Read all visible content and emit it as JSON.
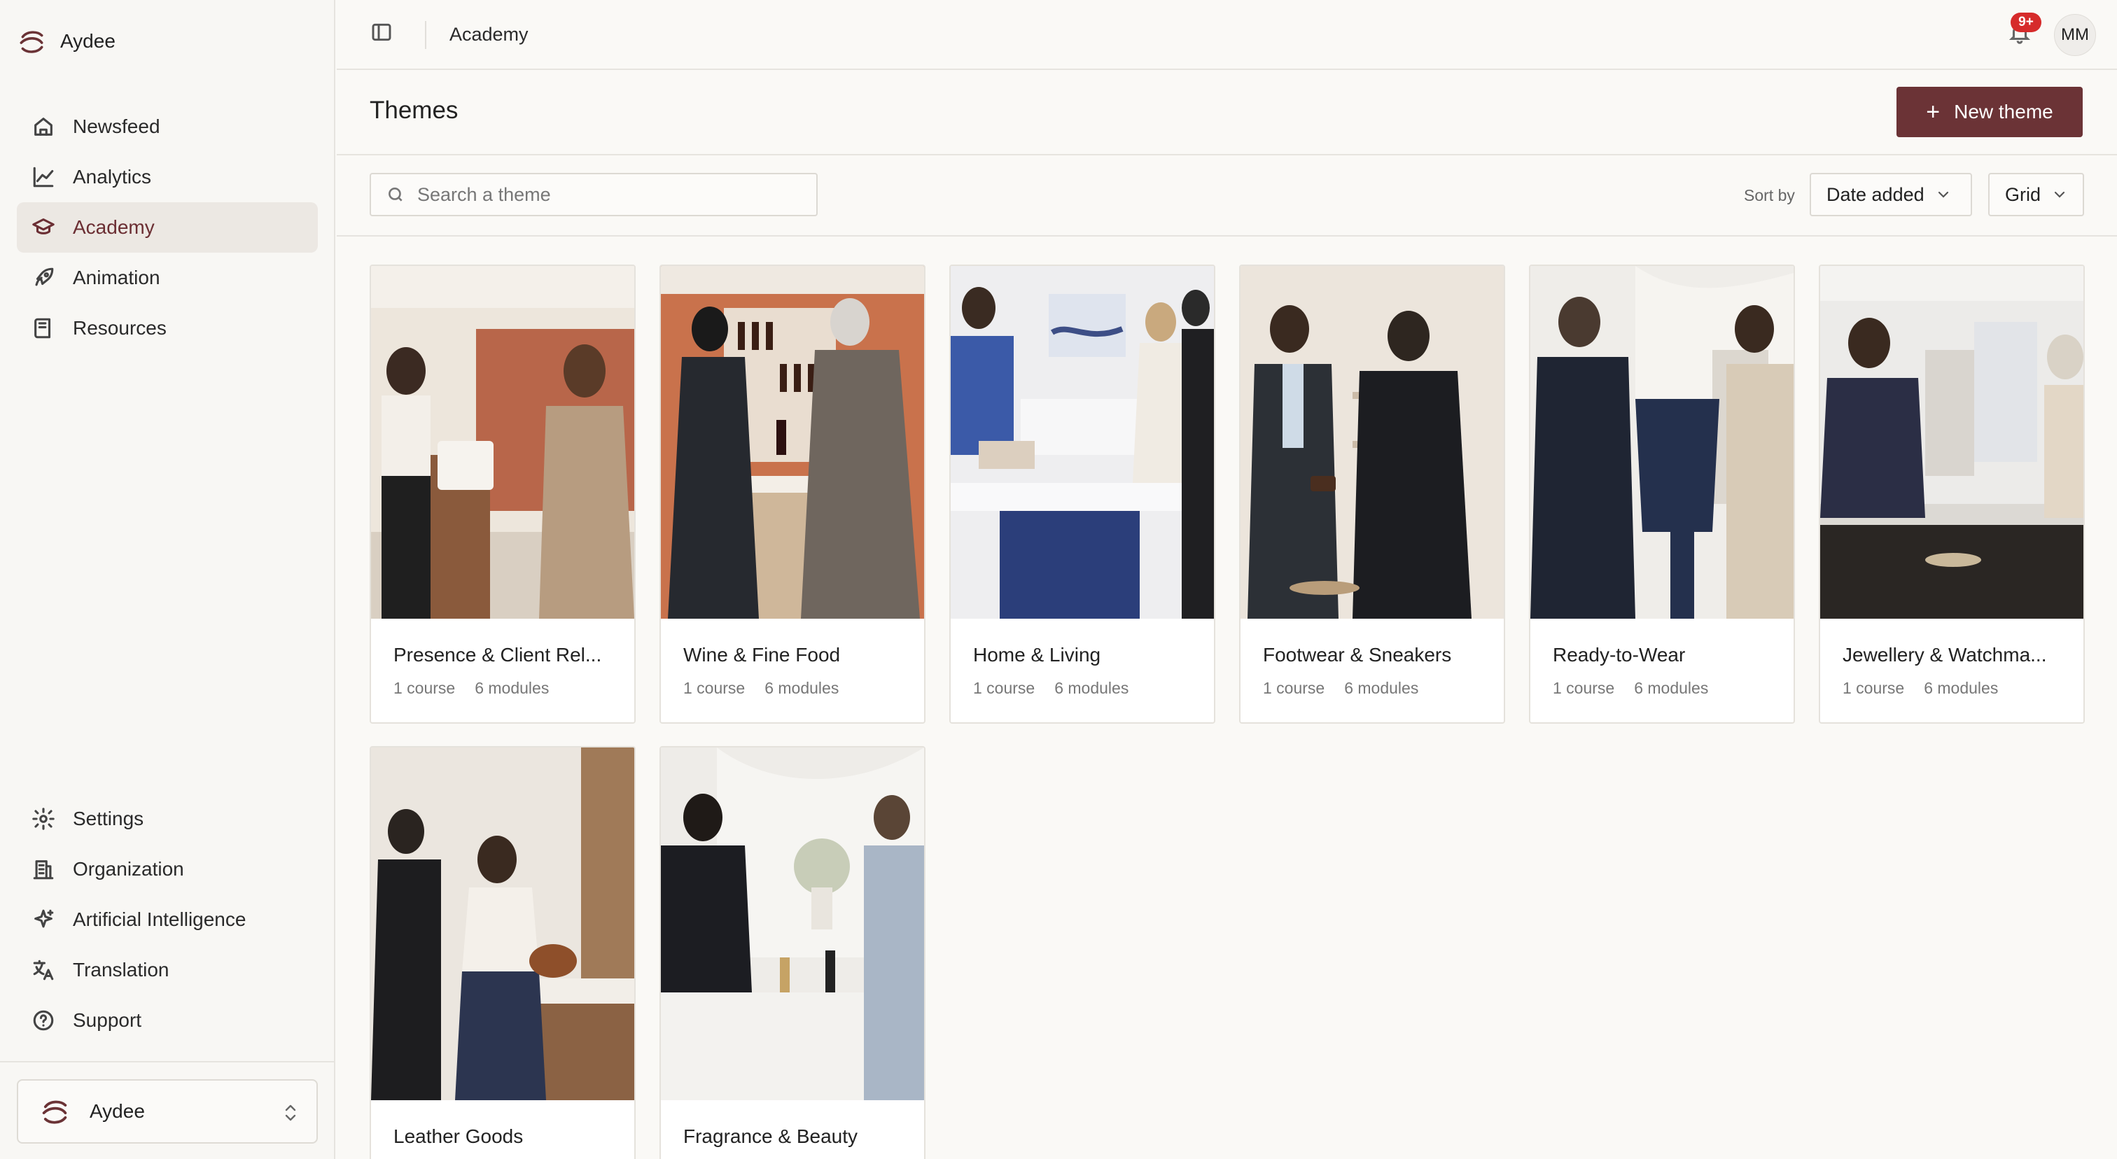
{
  "brand": {
    "name": "Aydee"
  },
  "sidebar": {
    "top_items": [
      {
        "label": "Newsfeed",
        "icon": "home-icon"
      },
      {
        "label": "Analytics",
        "icon": "chart-line-icon"
      },
      {
        "label": "Academy",
        "icon": "graduation-cap-icon",
        "active": true
      },
      {
        "label": "Animation",
        "icon": "rocket-icon"
      },
      {
        "label": "Resources",
        "icon": "book-icon"
      }
    ],
    "bottom_items": [
      {
        "label": "Settings",
        "icon": "gear-icon"
      },
      {
        "label": "Organization",
        "icon": "building-icon"
      },
      {
        "label": "Artificial Intelligence",
        "icon": "sparkles-icon"
      },
      {
        "label": "Translation",
        "icon": "translate-icon"
      },
      {
        "label": "Support",
        "icon": "help-circle-icon"
      }
    ],
    "org_switcher": {
      "name": "Aydee"
    }
  },
  "topbar": {
    "breadcrumb": "Academy",
    "notification_badge": "9+",
    "avatar_initials": "MM"
  },
  "header": {
    "title": "Themes",
    "new_button": "New theme"
  },
  "filters": {
    "search_placeholder": "Search a theme",
    "sort_label": "Sort by",
    "sort_value": "Date added",
    "view_value": "Grid"
  },
  "themes": [
    {
      "title": "Presence & Client Rel...",
      "courses": "1 course",
      "modules": "6 modules"
    },
    {
      "title": "Wine & Fine Food",
      "courses": "1 course",
      "modules": "6 modules"
    },
    {
      "title": "Home & Living",
      "courses": "1 course",
      "modules": "6 modules"
    },
    {
      "title": "Footwear & Sneakers",
      "courses": "1 course",
      "modules": "6 modules"
    },
    {
      "title": "Ready-to-Wear",
      "courses": "1 course",
      "modules": "6 modules"
    },
    {
      "title": "Jewellery & Watchma...",
      "courses": "1 course",
      "modules": "6 modules"
    },
    {
      "title": "Leather Goods",
      "courses": "",
      "modules": ""
    },
    {
      "title": "Fragrance & Beauty",
      "courses": "",
      "modules": ""
    }
  ],
  "colors": {
    "accent": "#6b3336",
    "active_nav_bg": "#ece8e3",
    "badge": "#d62b2b"
  }
}
